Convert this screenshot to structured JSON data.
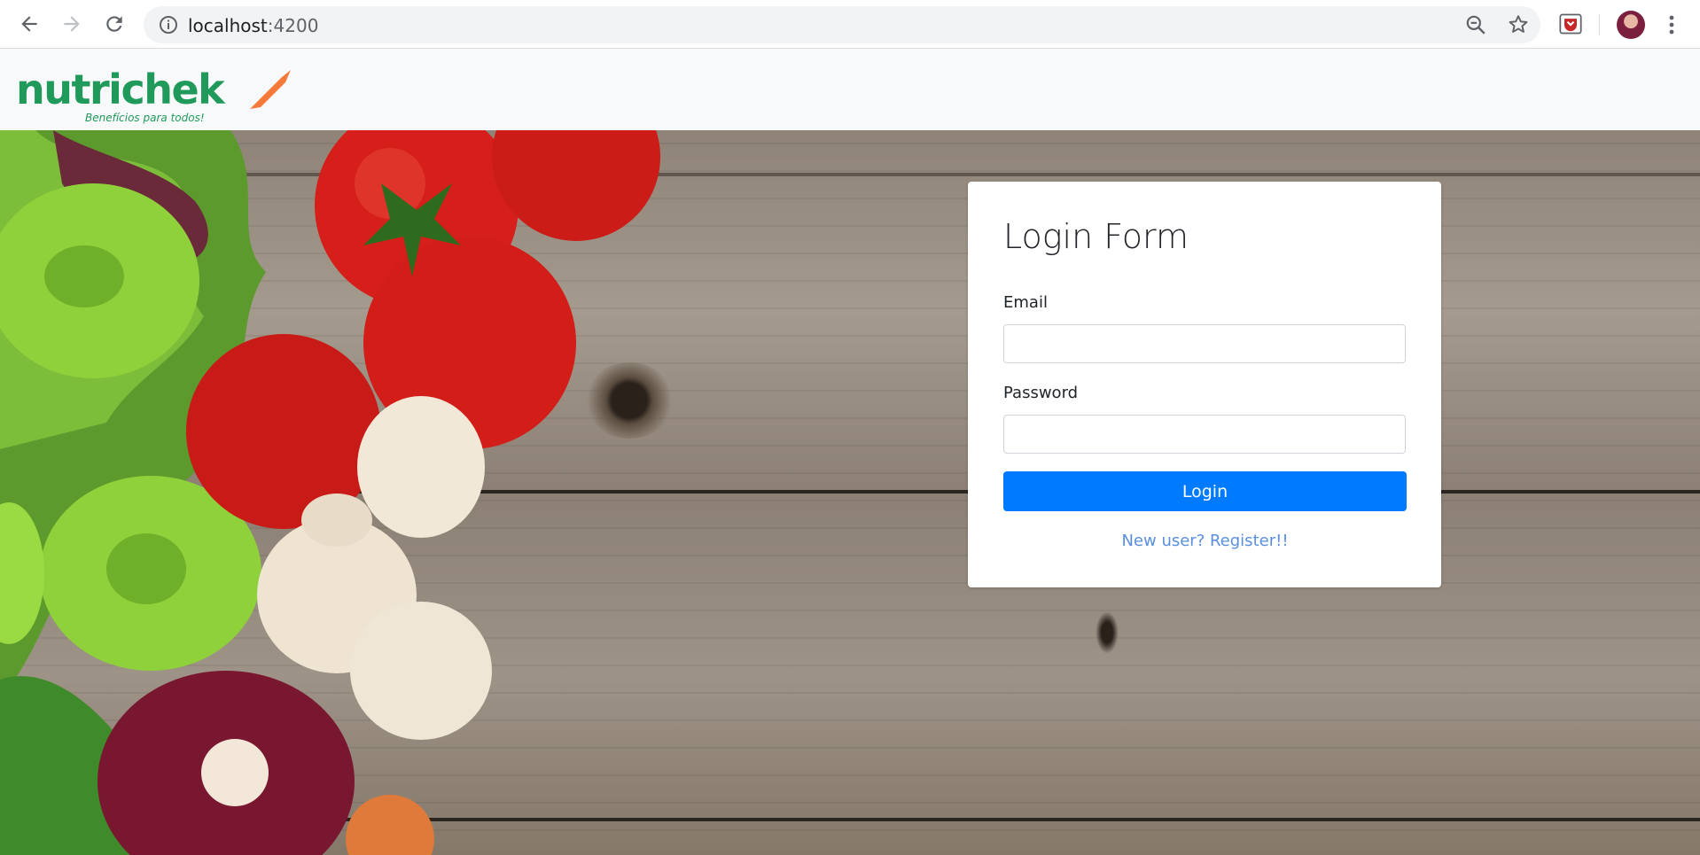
{
  "browser": {
    "url_host": "localhost",
    "url_port": ":4200",
    "icons": [
      "back-arrow-icon",
      "forward-arrow-icon",
      "reload-icon",
      "info-icon",
      "zoom-out-icon",
      "star-icon",
      "extension-icon",
      "profile-avatar",
      "menu-dots-icon"
    ]
  },
  "navbar": {
    "brand_name": "nutrichek",
    "tagline": "Benefícios para todos!",
    "colors": {
      "brand_green": "#1f9a5a",
      "brand_orange": "#f47a3c"
    }
  },
  "login": {
    "title": "Login Form",
    "email_label": "Email",
    "email_value": "",
    "password_label": "Password",
    "password_value": "",
    "submit_label": "Login",
    "register_link": "New user? Register!!"
  },
  "colors": {
    "primary_button": "#007bff",
    "link": "#5a8fe0",
    "navbar_bg": "#f8f9fa"
  }
}
